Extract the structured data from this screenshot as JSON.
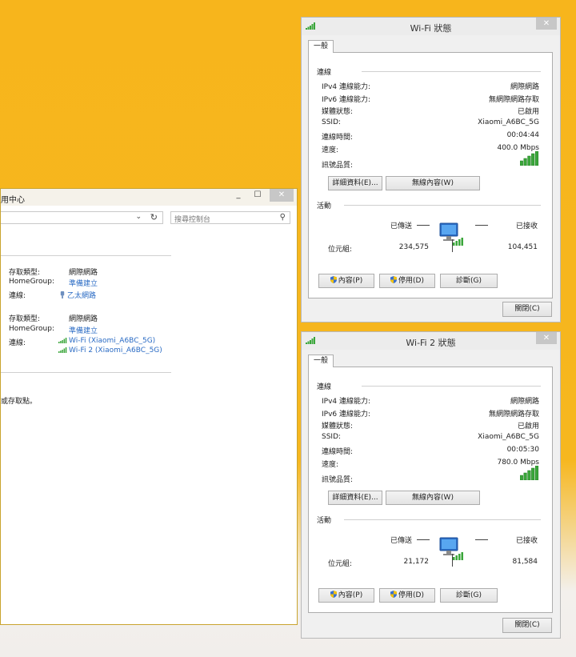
{
  "nsc": {
    "title_fragment": "用中心",
    "minimize": "_",
    "maximize": "☐",
    "close": "✕",
    "chevron": "⌄",
    "refresh": "↻",
    "search_placeholder": "搜尋控制台",
    "networks": [
      {
        "access_type_label": "存取類型:",
        "access_type_value": "網際網路",
        "homegroup_label": "HomeGroup:",
        "homegroup_value": "準備建立",
        "connection_label": "連線:",
        "connections": [
          "乙太網路"
        ]
      },
      {
        "access_type_label": "存取類型:",
        "access_type_value": "網際網路",
        "homegroup_label": "HomeGroup:",
        "homegroup_value": "準備建立",
        "connection_label": "連線:",
        "connections": [
          "Wi-Fi (Xiaomi_A6BC_5G)",
          "Wi-Fi 2 (Xiaomi_A6BC_5G)"
        ]
      }
    ],
    "bottom_text": "或存取點。"
  },
  "dialogs": [
    {
      "title": "Wi-Fi 狀態",
      "tab": "一般",
      "connection_section": "連線",
      "rows": [
        {
          "label": "IPv4 連線能力:",
          "value": "網際網路"
        },
        {
          "label": "IPv6 連線能力:",
          "value": "無網際網路存取"
        },
        {
          "label": "媒體狀態:",
          "value": "已啟用"
        },
        {
          "label": "SSID:",
          "value": "Xiaomi_A6BC_5G"
        },
        {
          "label": "連線時間:",
          "value": "00:04:44"
        },
        {
          "label": "速度:",
          "value": "400.0 Mbps"
        }
      ],
      "signal_label": "訊號品質:",
      "signal_bars": 5,
      "details_button": "詳細資料(E)...",
      "wireless_button": "無線內容(W)",
      "activity_section": "活動",
      "sent_label": "已傳送",
      "received_label": "已接收",
      "bytes_label": "位元組:",
      "bytes_sent": "234,575",
      "bytes_received": "104,451",
      "properties_button": "內容(P)",
      "disable_button": "停用(D)",
      "diagnose_button": "診斷(G)",
      "close_button": "關閉(C)",
      "close_icon": "✕"
    },
    {
      "title": "Wi-Fi 2 狀態",
      "tab": "一般",
      "connection_section": "連線",
      "rows": [
        {
          "label": "IPv4 連線能力:",
          "value": "網際網路"
        },
        {
          "label": "IPv6 連線能力:",
          "value": "無網際網路存取"
        },
        {
          "label": "媒體狀態:",
          "value": "已啟用"
        },
        {
          "label": "SSID:",
          "value": "Xiaomi_A6BC_5G"
        },
        {
          "label": "連線時間:",
          "value": "00:05:30"
        },
        {
          "label": "速度:",
          "value": "780.0 Mbps"
        }
      ],
      "signal_label": "訊號品質:",
      "signal_bars": 5,
      "details_button": "詳細資料(E)...",
      "wireless_button": "無線內容(W)",
      "activity_section": "活動",
      "sent_label": "已傳送",
      "received_label": "已接收",
      "bytes_label": "位元組:",
      "bytes_sent": "21,172",
      "bytes_received": "81,584",
      "properties_button": "內容(P)",
      "disable_button": "停用(D)",
      "diagnose_button": "診斷(G)",
      "close_button": "關閉(C)",
      "close_icon": "✕"
    }
  ],
  "colors": {
    "desktop": "#f7b51c",
    "signal_green": "#3aa63a",
    "link_blue": "#2a6bc4",
    "shield_blue": "#3a6fcf",
    "shield_yellow": "#f2c20f"
  }
}
